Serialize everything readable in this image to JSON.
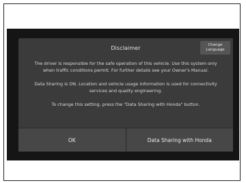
{
  "dialog": {
    "title": "Disclaimer",
    "change_language_line1": "Change",
    "change_language_line2": "Language",
    "paragraph1": "The driver is responsible for the safe operation of this vehicle. Use this system only when traffic conditions permit. For further details see your Owner's Manual.",
    "paragraph2": "Data Sharing is ON. Location and vehicle usage information is used for connectivity services and quality engineering.",
    "paragraph3": "To change this setting, press the \"Data Sharing with Honda\" button.",
    "ok_label": "OK",
    "data_sharing_label": "Data Sharing with Honda"
  },
  "colors": {
    "screen_bg": "#151515",
    "dialog_bg": "#3b3b3b",
    "button_bg": "#474747",
    "text": "#dcdcdc"
  }
}
